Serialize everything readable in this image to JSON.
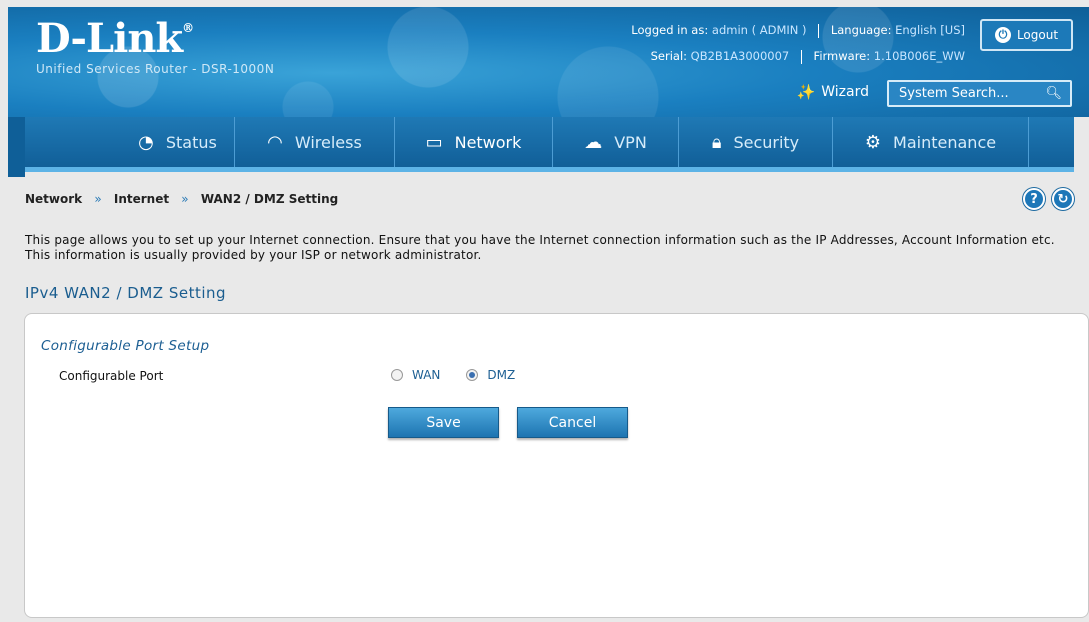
{
  "header": {
    "brand": "D-Link",
    "reg": "®",
    "subtitle": "Unified Services Router - DSR-1000N",
    "logged_in_label": "Logged in as:",
    "logged_in_value": "admin ( ADMIN )",
    "language_label": "Language:",
    "language_value": "English [US]",
    "serial_label": "Serial:",
    "serial_value": "QB2B1A3000007",
    "firmware_label": "Firmware:",
    "firmware_value": "1.10B006E_WW",
    "logout_label": "Logout",
    "wizard_label": "Wizard",
    "search_placeholder": "System Search..."
  },
  "nav": {
    "items": [
      {
        "label": "Status",
        "icon": "dashboard-icon"
      },
      {
        "label": "Wireless",
        "icon": "wifi-icon"
      },
      {
        "label": "Network",
        "icon": "computer-icon"
      },
      {
        "label": "VPN",
        "icon": "cloud-lock-icon"
      },
      {
        "label": "Security",
        "icon": "lock-icon"
      },
      {
        "label": "Maintenance",
        "icon": "gears-icon"
      }
    ],
    "active": "Network"
  },
  "breadcrumb": {
    "items": [
      "Network",
      "Internet",
      "WAN2 / DMZ Setting"
    ],
    "separator": "»"
  },
  "intro_text": "This page allows you to set up your Internet connection. Ensure that you have the Internet connection information such as the IP Addresses, Account Information etc. This information is usually provided by your ISP or network administrator.",
  "section_title": "IPv4 WAN2 / DMZ Setting",
  "panel": {
    "title": "Configurable Port Setup",
    "field_label": "Configurable Port",
    "options": [
      "WAN",
      "DMZ"
    ],
    "selected": "DMZ",
    "save_label": "Save",
    "cancel_label": "Cancel"
  },
  "colors": {
    "header_blue": "#1a7fc0",
    "nav_blue": "#115f98",
    "accent_text": "#1d5f93"
  }
}
